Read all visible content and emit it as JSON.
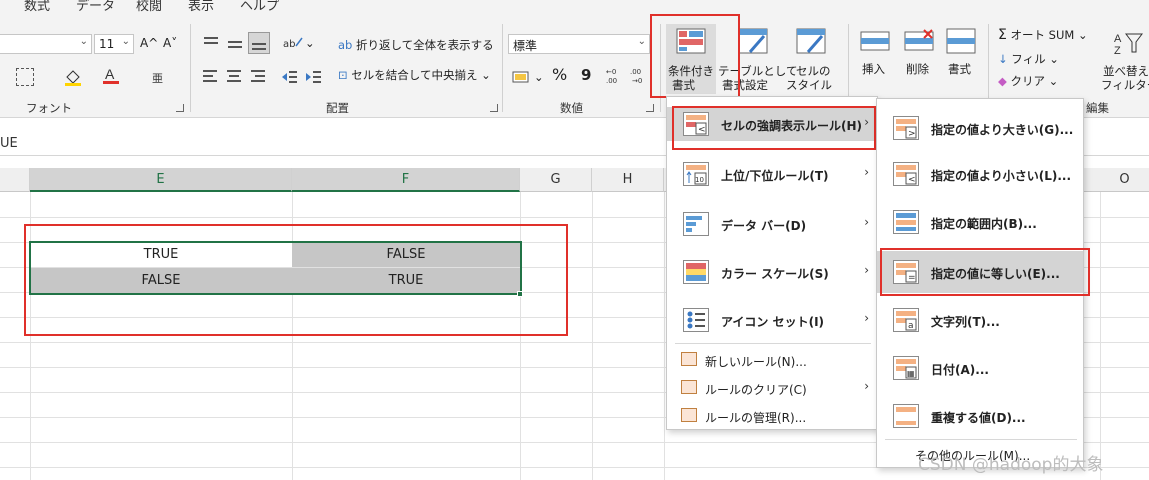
{
  "menu_tabs": [
    "数式",
    "データ",
    "校閲",
    "表示",
    "ヘルプ"
  ],
  "font": {
    "size": "11",
    "grow": "A^",
    "shrink": "A˅",
    "group_label": "フォント"
  },
  "alignment": {
    "wrap_label": "折り返して全体を表示する",
    "merge_label": "セルを結合して中央揃え",
    "group_label": "配置"
  },
  "number": {
    "format": "標準",
    "percent": "%",
    "comma": "9",
    "group_label": "数値"
  },
  "styles": {
    "conditional_label_1": "条件付き",
    "conditional_label_2": "書式",
    "table_label_1": "テーブルとして",
    "table_label_2": "書式設定",
    "cell_style_label_1": "セルの",
    "cell_style_label_2": "スタイル"
  },
  "cells_group": {
    "insert": "挿入",
    "delete": "削除",
    "format": "書式"
  },
  "editing": {
    "autosum": "オート SUM",
    "fill": "フィル",
    "clear": "クリア",
    "sort_1": "並べ替えと",
    "sort_2": "フィルター",
    "group_label": "編集"
  },
  "formula_bar": {
    "text": "UE"
  },
  "columns": [
    "E",
    "F",
    "G",
    "H",
    "O"
  ],
  "cells": [
    [
      "TRUE",
      "FALSE"
    ],
    [
      "FALSE",
      "TRUE"
    ]
  ],
  "main_menu": {
    "items": [
      {
        "label": "セルの強調表示ルール(H)",
        "icon": "highlight-rules-icon"
      },
      {
        "label": "上位/下位ルール(T)",
        "icon": "top-bottom-icon"
      },
      {
        "label": "データ バー(D)",
        "icon": "data-bar-icon"
      },
      {
        "label": "カラー スケール(S)",
        "icon": "color-scale-icon"
      },
      {
        "label": "アイコン セット(I)",
        "icon": "icon-set-icon"
      }
    ],
    "small_items": [
      {
        "label": "新しいルール(N)..."
      },
      {
        "label": "ルールのクリア(C)"
      },
      {
        "label": "ルールの管理(R)..."
      }
    ]
  },
  "sub_menu": {
    "items": [
      {
        "label": "指定の値より大きい(G)...",
        "glyph": ">"
      },
      {
        "label": "指定の値より小さい(L)...",
        "glyph": "<"
      },
      {
        "label": "指定の範囲内(B)...",
        "glyph": ""
      },
      {
        "label": "指定の値に等しい(E)...",
        "glyph": "="
      },
      {
        "label": "文字列(T)...",
        "glyph": "a"
      },
      {
        "label": "日付(A)...",
        "glyph": "▦"
      },
      {
        "label": "重複する値(D)...",
        "glyph": ""
      }
    ],
    "more": "その他のルール(M)..."
  },
  "watermark": "CSDN @hadoop的大象",
  "colors": {
    "accent_green": "#217346",
    "highlight_red": "#e0302a",
    "cell_grey": "#c6c6c6",
    "icon_red": "#e06666",
    "icon_orange": "#f4b183",
    "icon_blue": "#5b9bd5"
  }
}
